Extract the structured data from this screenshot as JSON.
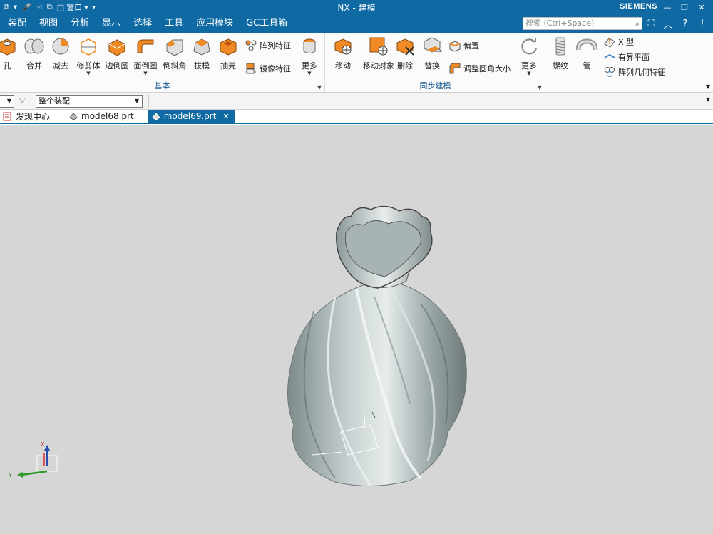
{
  "titlebar": {
    "title": "NX - 建模",
    "brand": "SIEMENS",
    "window_menu_label": "窗口"
  },
  "menubar": {
    "items": [
      "装配",
      "视图",
      "分析",
      "显示",
      "选择",
      "工具",
      "应用模块",
      "GC工具箱"
    ],
    "search_placeholder": "搜索 (Ctrl+Space)"
  },
  "ribbon": {
    "groups": {
      "basic": {
        "label": "基本",
        "tools": [
          "孔",
          "合并",
          "减去",
          "修剪体",
          "边倒圆",
          "面倒圆",
          "倒斜角",
          "拔模",
          "抽壳",
          "阵列特征",
          "镜像特征",
          "更多"
        ]
      },
      "sync": {
        "label": "同步建模",
        "tools": [
          "移动",
          "移动对象",
          "删除",
          "替换",
          "偏置",
          "调整圆角大小",
          "更多"
        ]
      },
      "extra": {
        "tools": [
          "螺纹",
          "管",
          "X 型",
          "有界平面",
          "阵列几何特征"
        ]
      }
    }
  },
  "selection_bar": {
    "scope": "整个装配"
  },
  "tabs": [
    {
      "label": "发现中心"
    },
    {
      "label": "model68.prt"
    },
    {
      "label": "model69.prt"
    }
  ],
  "triad": {
    "x_label": "X",
    "y_label": "Y"
  },
  "colors": {
    "nx_blue": "#0f6aa3",
    "viewport_bg": "#d6d6d6",
    "feature_orange": "#f08a24"
  }
}
